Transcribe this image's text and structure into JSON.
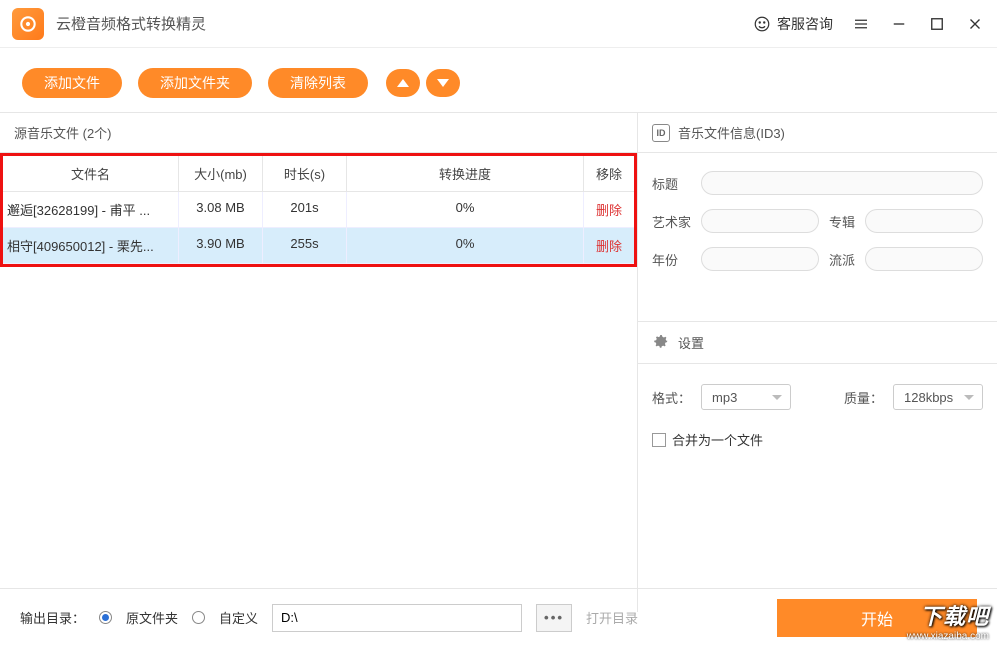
{
  "app": {
    "title": "云橙音频格式转换精灵",
    "support": "客服咨询"
  },
  "toolbar": {
    "add_file": "添加文件",
    "add_folder": "添加文件夹",
    "clear_list": "清除列表"
  },
  "left": {
    "header": "源音乐文件 (2个)",
    "columns": {
      "name": "文件名",
      "size": "大小(mb)",
      "duration": "时长(s)",
      "progress": "转换进度",
      "remove": "移除"
    },
    "rows": [
      {
        "name": "邂逅[32628199] - 甫平 ...",
        "size": "3.08 MB",
        "duration": "201s",
        "progress": "0%",
        "remove": "删除"
      },
      {
        "name": "相守[409650012] - 栗先...",
        "size": "3.90 MB",
        "duration": "255s",
        "progress": "0%",
        "remove": "删除"
      }
    ]
  },
  "id3": {
    "header": "音乐文件信息(ID3)",
    "title_lbl": "标题",
    "artist_lbl": "艺术家",
    "album_lbl": "专辑",
    "year_lbl": "年份",
    "genre_lbl": "流派"
  },
  "settings": {
    "header": "设置",
    "format_lbl": "格式：",
    "format_val": "mp3",
    "quality_lbl": "质量：",
    "quality_val": "128kbps",
    "merge_lbl": "合并为一个文件"
  },
  "bottom": {
    "output_lbl": "输出目录：",
    "orig_folder": "原文件夹",
    "custom": "自定义",
    "path": "D:\\",
    "open_dir": "打开目录",
    "start": "开始"
  },
  "watermark": {
    "line1": "下载吧",
    "line2": "www.xiazaiba.com"
  }
}
